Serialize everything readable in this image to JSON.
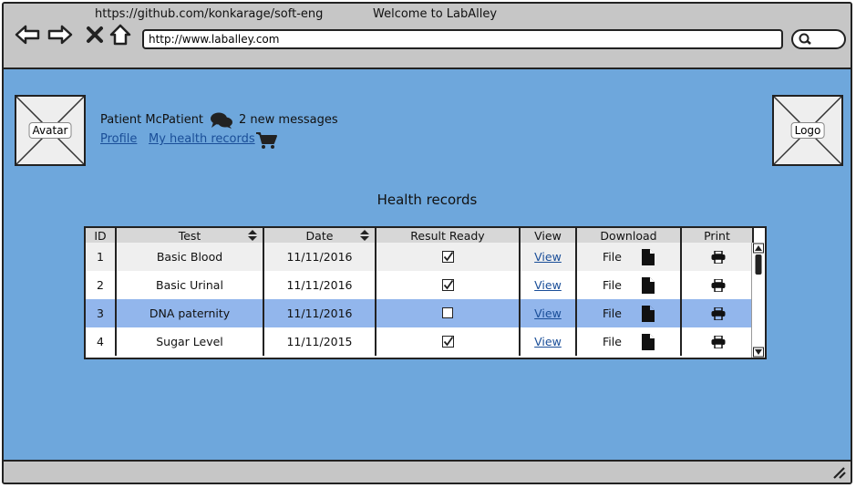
{
  "browser": {
    "top_url": "https://github.com/konkarage/soft-eng",
    "window_title": "Welcome to LabAlley",
    "address": "http://www.laballey.com"
  },
  "header": {
    "avatar_label": "Avatar",
    "logo_label": "Logo",
    "user_name": "Patient McPatient",
    "messages": "2 new messages",
    "profile_link": "Profile",
    "records_link": "My health records"
  },
  "page": {
    "title": "Health records"
  },
  "table": {
    "columns": [
      "ID",
      "Test",
      "Date",
      "Result Ready",
      "View",
      "Download",
      "Print"
    ],
    "rows": [
      {
        "id": "1",
        "test": "Basic Blood",
        "date": "11/11/2016",
        "ready": true,
        "view": "View",
        "download": "File",
        "highlight": false
      },
      {
        "id": "2",
        "test": "Basic Urinal",
        "date": "11/11/2016",
        "ready": true,
        "view": "View",
        "download": "File",
        "highlight": false
      },
      {
        "id": "3",
        "test": "DNA paternity",
        "date": "11/11/2016",
        "ready": false,
        "view": "View",
        "download": "File",
        "highlight": true
      },
      {
        "id": "4",
        "test": "Sugar Level",
        "date": "11/11/2015",
        "ready": true,
        "view": "View",
        "download": "File",
        "highlight": false
      }
    ]
  }
}
